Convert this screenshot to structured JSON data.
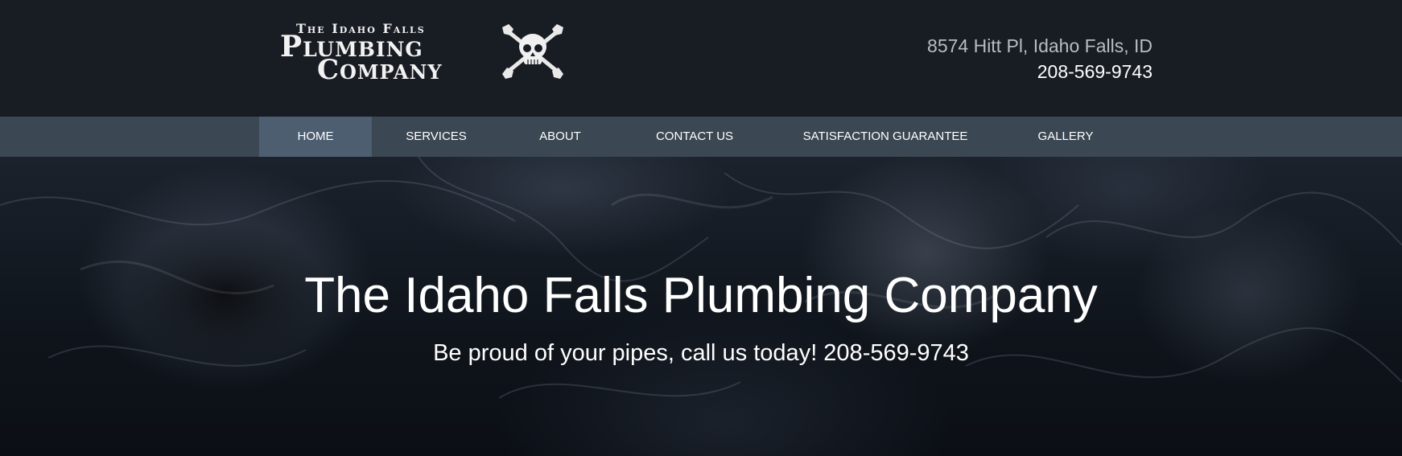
{
  "brand": {
    "logo_line1": "The Idaho Falls",
    "logo_line2": "Plumbing",
    "logo_line3": "Company",
    "logo_icon": "skull-crossed-wrenches-icon"
  },
  "header": {
    "address": "8574 Hitt Pl, Idaho Falls, ID",
    "phone": "208-569-9743"
  },
  "nav": {
    "items": [
      {
        "label": "HOME",
        "active": true
      },
      {
        "label": "SERVICES",
        "active": false
      },
      {
        "label": "ABOUT",
        "active": false
      },
      {
        "label": "CONTACT US",
        "active": false
      },
      {
        "label": "SATISFACTION GUARANTEE",
        "active": false
      },
      {
        "label": "GALLERY",
        "active": false
      }
    ]
  },
  "hero": {
    "title": "The Idaho Falls Plumbing Company",
    "subtitle": "Be proud of your pipes, call us today! 208-569-9743"
  },
  "colors": {
    "header_bg": "#181c23",
    "nav_bg": "#3b4753",
    "nav_active_bg": "#4c5e70",
    "address_text": "#b9bcc1",
    "text": "#ffffff"
  }
}
